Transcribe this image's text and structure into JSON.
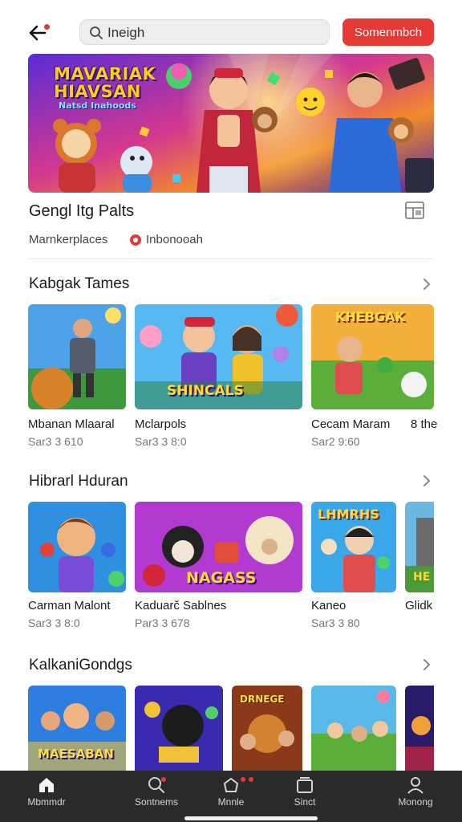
{
  "header": {
    "search_value": "Ineigh",
    "cta_label": "Somenmbch"
  },
  "banner": {
    "title_line1": "MAVARIAK",
    "title_line2": "HIAVSAN",
    "subtitle": "Natsd Inahoods"
  },
  "store": {
    "title": "Gengl Itg Palts",
    "chip_marketplace": "Marnkerplaces",
    "chip_inbox": "Inbonooah"
  },
  "sections": [
    {
      "title": "Kabgak Tames",
      "items": [
        {
          "name": "Mbanan Mlaaral",
          "price": "Sar3 3 610",
          "overlay": ""
        },
        {
          "name": "Mclarpols",
          "price": "Sar3 3 8:0",
          "overlay": "SHINCALS"
        },
        {
          "name": "Cecam Maram",
          "price": "Sar2 9:60",
          "overlay": "KHEBGAK"
        },
        {
          "name": "8 the",
          "price": "",
          "overlay": ""
        }
      ]
    },
    {
      "title": "Hibrarl Hduran",
      "items": [
        {
          "name": "Carman Malont",
          "price": "Sar3 3 8:0",
          "overlay": ""
        },
        {
          "name": "Kaduarč Sablnes",
          "price": "Par3 3 678",
          "overlay": "NAGASS"
        },
        {
          "name": "Kaneo",
          "price": "Sar3 3 80",
          "overlay": "LHMRHS"
        },
        {
          "name": "Glidk",
          "price": "",
          "overlay": "HE"
        }
      ]
    },
    {
      "title": "KalkaniGondgs",
      "items": [
        {
          "name": "",
          "price": "",
          "overlay": "MAESABAN"
        },
        {
          "name": "",
          "price": "",
          "overlay": ""
        },
        {
          "name": "",
          "price": "",
          "overlay": "DRNEGE"
        },
        {
          "name": "",
          "price": "",
          "overlay": ""
        },
        {
          "name": "",
          "price": "",
          "overlay": ""
        }
      ]
    }
  ],
  "bottom_nav": [
    {
      "label": "Mbmmdr",
      "icon": "home-icon"
    },
    {
      "label": "Sontnems",
      "icon": "search-icon"
    },
    {
      "label": "Mnnle",
      "icon": "bag-icon"
    },
    {
      "label": "Sinct",
      "icon": "library-icon"
    },
    {
      "label": "Monong",
      "icon": "profile-icon"
    }
  ],
  "colors": {
    "accent": "#e53935",
    "nav_bg": "#2a2a2a"
  }
}
